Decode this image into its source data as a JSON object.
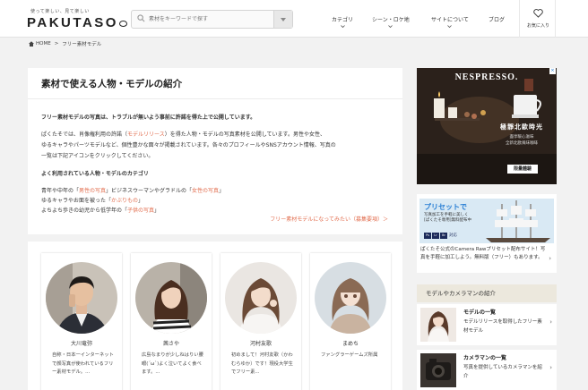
{
  "header": {
    "tagline": "使って楽しい、見て楽しい",
    "logo": "PAKUTASO",
    "search_placeholder": "素材をキーワードで探す",
    "nav": [
      {
        "label": "カテゴリ"
      },
      {
        "label": "シーン・ロケ地"
      },
      {
        "label": "サイトについて"
      },
      {
        "label": "ブログ"
      }
    ],
    "favorites_label": "お気に入り"
  },
  "breadcrumb": {
    "home": "HOME",
    "separator": ">",
    "current": "フリー素材モデル"
  },
  "main": {
    "title": "素材で使える人物・モデルの紹介",
    "lead": "フリー素材モデルの写真は、トラブルが無いよう事前に許諾を得た上で公開しています。",
    "intro_line1_pre": "ぱくたそでは、肖像権利用の許諾（",
    "intro_line1_link": "モデルリリース",
    "intro_line1_post": "）を得た人物・モデルの写真素材を公開しています。男性や女性、",
    "intro_line2": "ゆるキャラやパーツモデルなど、個性豊かな面々が掲載されています。各々のプロフィールやSNSアカウント情報、写真の",
    "intro_line3": "一覧は下記アイコンをクリックしてください。",
    "category_heading": "よく利用されている人物・モデルのカテゴリ",
    "cat_line1_pre": "青年や中年の「",
    "cat_line1_link1": "男性の写真",
    "cat_line1_mid": "」ビジネスウーマンやグラドルの「",
    "cat_line1_link2": "女性の写真",
    "cat_line1_post": "」",
    "cat_line2_pre": "ゆるキャラやお面を被った「",
    "cat_line2_link": "かぶりもの",
    "cat_line2_post": "」",
    "cat_line3_pre": "よちよち歩きの幼児から低学年の「",
    "cat_line3_link": "子供の写真",
    "cat_line3_post": "」",
    "apply_link": "フリー素材モデルになってみたい（募集要項）＞"
  },
  "models": [
    {
      "name": "大川竜弥",
      "desc": "自称・日本一インターネットで顔写真が使われているフリー素材モデル。..."
    },
    {
      "name": "茜さや",
      "desc": "広島なまりが少しねはりい腰眼(´ω`)よく泣いてよく食べます。..."
    },
    {
      "name": "河村友歌",
      "desc": "初めまして！河村友歌（かわむらゆか）です！現役大学生でフリー素..."
    },
    {
      "name": "まめち",
      "desc": "ファングラーゲームズ所属"
    }
  ],
  "ad": {
    "brand": "NESPRESSO.",
    "close": "×",
    "copy_main": "極靜北歐時光",
    "copy_sub1": "盡享暖心滋味",
    "copy_sub2": "全新北歐風味咖啡",
    "cta": "限量體驗"
  },
  "promo": {
    "title": "プリセットで",
    "sub1": "写真加工を手軽に美しく",
    "sub2": "[ぱくたそ専用]無料配布中",
    "badges": [
      "Ps",
      "Lr",
      "Br"
    ],
    "badge_suffix": "対応",
    "text": "ぱくたそ公式のCamera Rawプリセット配布サイト！写真を手軽に加工しよう。無料版（フリー）もあります。",
    "chevron": "›"
  },
  "sidebar": {
    "heading": "モデルやカメラマンの紹介",
    "items": [
      {
        "title": "モデルの一覧",
        "desc": "モデルリリースを取得したフリー素材モデル",
        "chevron": "›"
      },
      {
        "title": "カメラマンの一覧",
        "desc": "写真を提供しているカメラマンを紹介",
        "chevron": "›"
      }
    ]
  },
  "colors": {
    "accent": "#e26e4f",
    "promo_blue": "#2a7fd4",
    "sidebar_head_bg": "#ece8dd"
  }
}
